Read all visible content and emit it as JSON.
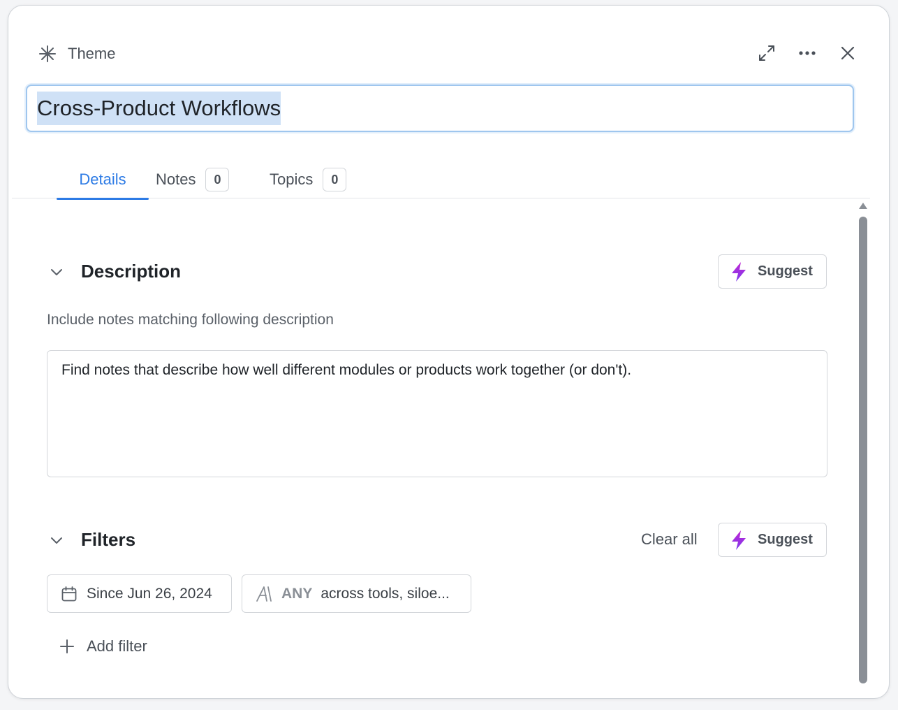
{
  "header": {
    "theme_label": "Theme",
    "icons": [
      "asterisk-icon",
      "expand-icon",
      "more-icon",
      "close-icon"
    ]
  },
  "title": {
    "value": "Cross-Product Workflows"
  },
  "tabs": [
    {
      "label": "Details",
      "active": true
    },
    {
      "label": "Notes",
      "count": "0"
    },
    {
      "label": "Topics",
      "count": "0"
    }
  ],
  "description": {
    "title": "Description",
    "suggest_label": "Suggest",
    "hint": "Include notes matching following description",
    "text": "Find notes that describe how well different modules or products work together (or don't)."
  },
  "filters": {
    "title": "Filters",
    "clear_all_label": "Clear all",
    "suggest_label": "Suggest",
    "chips": [
      {
        "label": "Since Jun 26, 2024",
        "icon": "calendar-icon"
      },
      {
        "prefix": "ANY",
        "label": "across tools, siloe...",
        "icon": "font-icon"
      }
    ],
    "add_filter_label": "Add filter"
  },
  "colors": {
    "accent": "#2d7be5",
    "bolt_top": "#c026d3",
    "bolt_bottom": "#7c3aed"
  }
}
